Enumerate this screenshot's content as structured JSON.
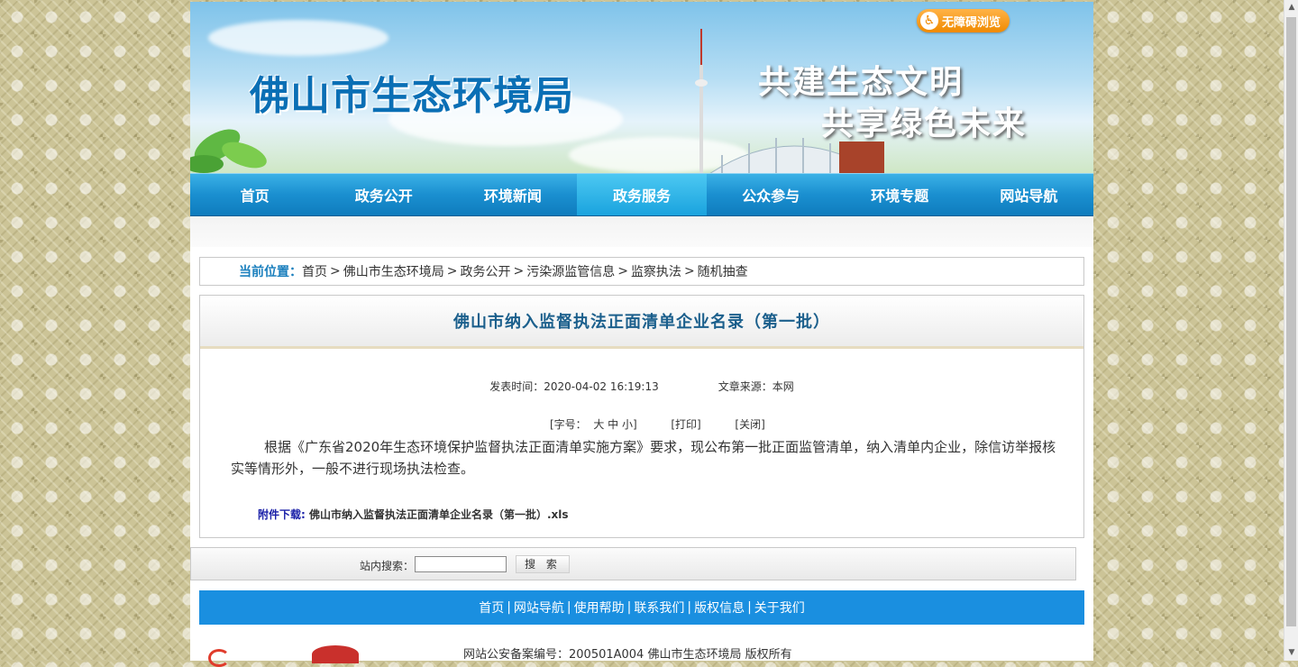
{
  "header": {
    "site_title": "佛山市生态环境局",
    "slogan_line1": "共建生态文明",
    "slogan_line2": "共享绿色未来",
    "accessibility_label": "无障碍浏览"
  },
  "nav": {
    "items": [
      "首页",
      "政务公开",
      "环境新闻",
      "政务服务",
      "公众参与",
      "环境专题",
      "网站导航"
    ]
  },
  "breadcrumb": {
    "label": "当前位置：",
    "items": [
      "首页",
      "佛山市生态环境局",
      "政务公开",
      "污染源监管信息",
      "监察执法",
      "随机抽查"
    ],
    "separator": ">"
  },
  "article": {
    "title": "佛山市纳入监督执法正面清单企业名录（第一批）",
    "publish_label": "发表时间：",
    "publish_time": "2020-04-02 16:19:13",
    "source_label": "文章来源：",
    "source": "本网",
    "font_size_label": "[字号：",
    "font_large": "大",
    "font_medium": "中",
    "font_small": "小]",
    "print_label": "[打印]",
    "close_label": "[关闭]",
    "body": "根据《广东省2020年生态环境保护监督执法正面清单实施方案》要求，现公布第一批正面监管清单，纳入清单内企业，除信访举报核实等情形外，一般不进行现场执法检查。",
    "attachment_label": "附件下载:",
    "attachment_file": "佛山市纳入监督执法正面清单企业名录（第一批）.xls"
  },
  "search": {
    "label": "站内搜索：",
    "value": "",
    "button_label": "搜 索"
  },
  "footer": {
    "links": [
      "首页",
      "网站导航",
      "使用帮助",
      "联系我们",
      "版权信息",
      "关于我们"
    ],
    "separator": "|",
    "record": "网站公安备案编号：200501A004 佛山市生态环境局 版权所有"
  },
  "colors": {
    "nav_blue": "#1a8fd0",
    "title_blue": "#1b5f8c",
    "footer_blue": "#1a8fe0",
    "accent_orange": "#f08a00"
  }
}
